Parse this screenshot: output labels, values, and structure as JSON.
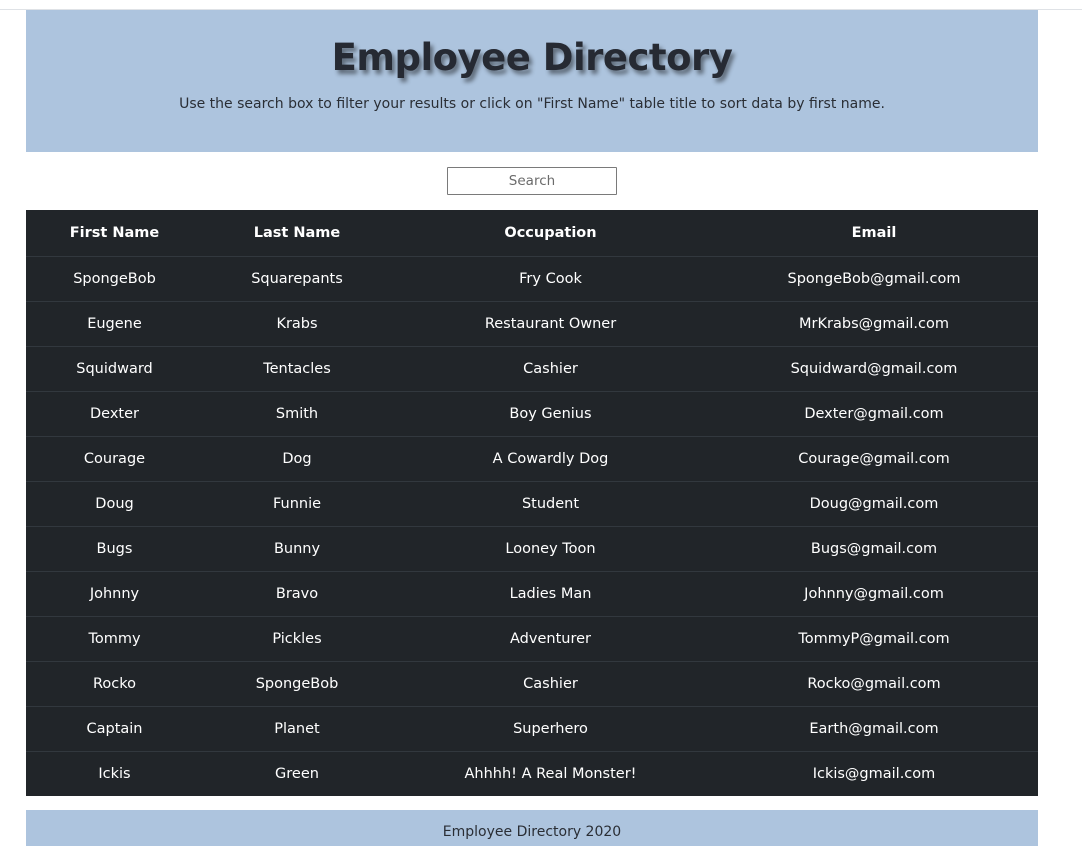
{
  "header": {
    "title": "Employee Directory",
    "subtitle": "Use the search box to filter your results or click on \"First Name\" table title to sort data by first name."
  },
  "search": {
    "placeholder": "Search",
    "value": ""
  },
  "table": {
    "columns": [
      "First Name",
      "Last Name",
      "Occupation",
      "Email"
    ],
    "rows": [
      [
        "SpongeBob",
        "Squarepants",
        "Fry Cook",
        "SpongeBob@gmail.com"
      ],
      [
        "Eugene",
        "Krabs",
        "Restaurant Owner",
        "MrKrabs@gmail.com"
      ],
      [
        "Squidward",
        "Tentacles",
        "Cashier",
        "Squidward@gmail.com"
      ],
      [
        "Dexter",
        "Smith",
        "Boy Genius",
        "Dexter@gmail.com"
      ],
      [
        "Courage",
        "Dog",
        "A Cowardly Dog",
        "Courage@gmail.com"
      ],
      [
        "Doug",
        "Funnie",
        "Student",
        "Doug@gmail.com"
      ],
      [
        "Bugs",
        "Bunny",
        "Looney Toon",
        "Bugs@gmail.com"
      ],
      [
        "Johnny",
        "Bravo",
        "Ladies Man",
        "Johnny@gmail.com"
      ],
      [
        "Tommy",
        "Pickles",
        "Adventurer",
        "TommyP@gmail.com"
      ],
      [
        "Rocko",
        "SpongeBob",
        "Cashier",
        "Rocko@gmail.com"
      ],
      [
        "Captain",
        "Planet",
        "Superhero",
        "Earth@gmail.com"
      ],
      [
        "Ickis",
        "Green",
        "Ahhhh! A Real Monster!",
        "Ickis@gmail.com"
      ]
    ]
  },
  "footer": {
    "text": "Employee Directory 2020"
  },
  "colors": {
    "header_bg": "#adc4de",
    "table_bg": "#212529",
    "table_text": "#ffffff",
    "row_divider": "#32383e"
  }
}
